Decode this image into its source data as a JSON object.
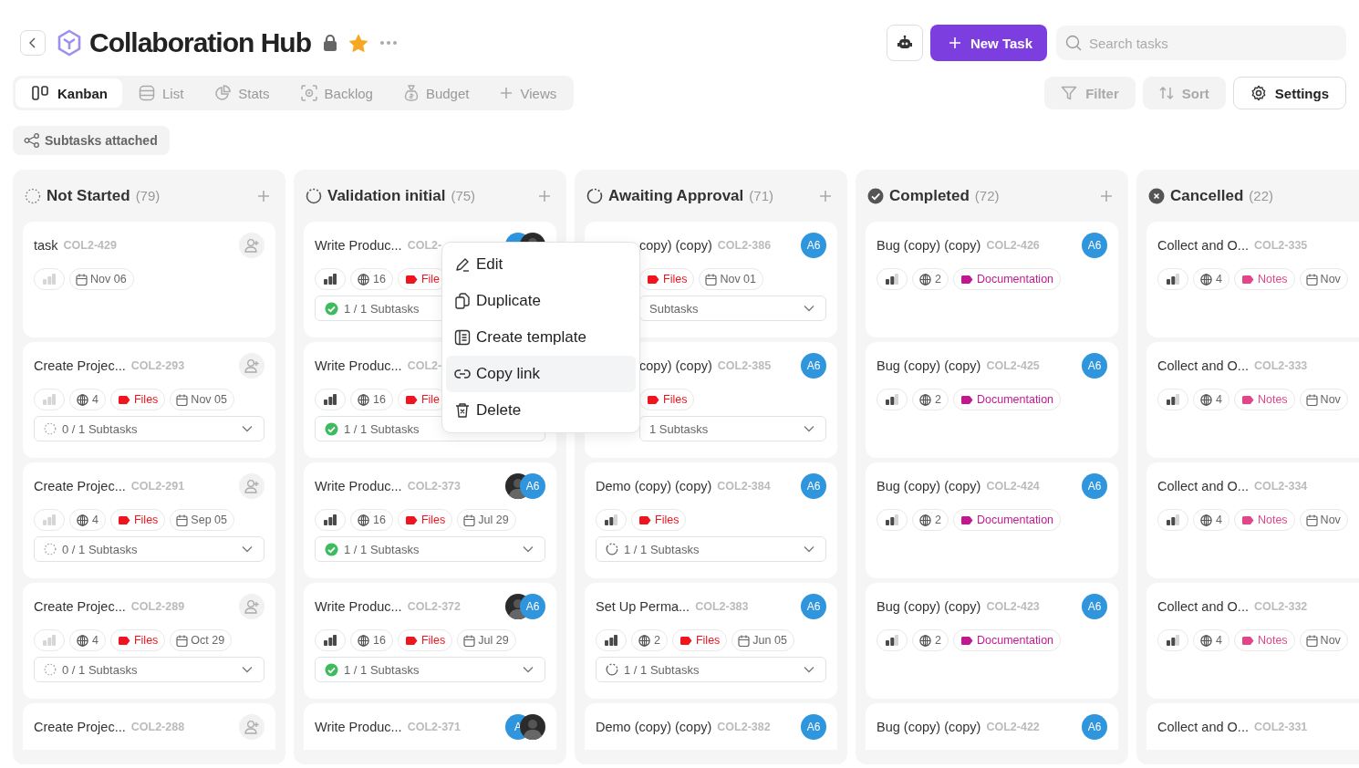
{
  "header": {
    "title": "Collaboration Hub",
    "locked": true,
    "starred": true,
    "new_task_button": "New Task",
    "search": {
      "placeholder": "Search tasks"
    }
  },
  "view_tabs": [
    {
      "label": "Kanban",
      "kind": "kanban",
      "selected": true
    },
    {
      "label": "List",
      "kind": "list",
      "selected": false
    },
    {
      "label": "Stats",
      "kind": "stats",
      "selected": false
    },
    {
      "label": "Backlog",
      "kind": "backlog",
      "selected": false
    },
    {
      "label": "Budget",
      "kind": "budget",
      "selected": false
    }
  ],
  "add_view": "Views",
  "toolbar_buttons": [
    {
      "label": "Filter",
      "kind": "filter",
      "disabled": true
    },
    {
      "label": "Sort",
      "kind": "sort",
      "disabled": true
    },
    {
      "label": "Settings",
      "kind": "settings",
      "disabled": false
    }
  ],
  "active_filter": "Subtasks attached",
  "columns": [
    {
      "title": "Not Started",
      "count": "(79)",
      "kind": "todo",
      "add_button": true,
      "cards": [
        {
          "title": "task",
          "code": "COL2-429",
          "assign_button": true,
          "level": 0,
          "chips": [
            {
              "kind": "date",
              "text": "Nov 06"
            }
          ]
        },
        {
          "title": "Create Projec...",
          "code": "COL2-293",
          "assign_button": true,
          "level": 0,
          "chips": [
            {
              "kind": "stat",
              "text": "4"
            },
            {
              "kind": "label",
              "text": "Files",
              "color": "#f0141e"
            },
            {
              "kind": "date",
              "text": "Nov 05"
            }
          ],
          "subtasks": {
            "text": "0 / 1 Subtasks",
            "kind": "todo"
          }
        },
        {
          "title": "Create Projec...",
          "code": "COL2-291",
          "assign_button": true,
          "level": 0,
          "chips": [
            {
              "kind": "stat",
              "text": "4"
            },
            {
              "kind": "label",
              "text": "Files",
              "color": "#f0141e"
            },
            {
              "kind": "date",
              "text": "Sep 05"
            }
          ],
          "subtasks": {
            "text": "0 / 1 Subtasks",
            "kind": "todo"
          }
        },
        {
          "title": "Create Projec...",
          "code": "COL2-289",
          "assign_button": true,
          "level": 0,
          "chips": [
            {
              "kind": "stat",
              "text": "4"
            },
            {
              "kind": "label",
              "text": "Files",
              "color": "#f0141e"
            },
            {
              "kind": "date",
              "text": "Oct 29"
            }
          ],
          "subtasks": {
            "text": "0 / 1 Subtasks",
            "kind": "todo"
          }
        },
        {
          "title": "Create Projec...",
          "code": "COL2-288",
          "assign_button": true
        }
      ]
    },
    {
      "title": "Validation initial",
      "count": "(75)",
      "kind": "progress",
      "add_button": true,
      "cards": [
        {
          "title": "Write Produc...",
          "code": "COL2-",
          "assignees": [
            {
              "kind": "initials"
            },
            {
              "kind": "photo"
            }
          ],
          "level": 1,
          "chips": [
            {
              "kind": "stat",
              "text": "16"
            },
            {
              "kind": "label",
              "text": "File",
              "color": "#f0141e"
            }
          ],
          "subtasks": {
            "text": "1 / 1 Subtasks",
            "kind": "done",
            "chevron": false
          }
        },
        {
          "title": "Write Produc...",
          "code": "COL2-",
          "level": 1,
          "chips": [
            {
              "kind": "stat",
              "text": "16"
            },
            {
              "kind": "label",
              "text": "File",
              "color": "#f0141e"
            }
          ],
          "subtasks": {
            "text": "1 / 1 Subtasks",
            "kind": "done",
            "chevron": false
          }
        },
        {
          "title": "Write Produc...",
          "code": "COL2-373",
          "assignees": [
            {
              "kind": "photo"
            },
            {
              "kind": "initials",
              "text": "A6"
            }
          ],
          "level": 1,
          "chips": [
            {
              "kind": "stat",
              "text": "16"
            },
            {
              "kind": "label",
              "text": "Files",
              "color": "#f0141e"
            },
            {
              "kind": "date",
              "text": "Jul 29"
            }
          ],
          "subtasks": {
            "text": "1 / 1 Subtasks",
            "kind": "done"
          }
        },
        {
          "title": "Write Produc...",
          "code": "COL2-372",
          "assignees": [
            {
              "kind": "photo"
            },
            {
              "kind": "initials",
              "text": "A6"
            }
          ],
          "level": 1,
          "chips": [
            {
              "kind": "stat",
              "text": "16"
            },
            {
              "kind": "label",
              "text": "Files",
              "color": "#f0141e"
            },
            {
              "kind": "date",
              "text": "Jul 29"
            }
          ],
          "subtasks": {
            "text": "1 / 1 Subtasks",
            "kind": "done"
          }
        },
        {
          "title": "Write Produc...",
          "code": "COL2-371",
          "assignees": [
            {
              "kind": "initials",
              "text": "A"
            },
            {
              "kind": "photo"
            }
          ]
        }
      ]
    },
    {
      "title": "Awaiting Approval",
      "count": "(71)",
      "kind": "review",
      "add_button": true,
      "cards": [
        {
          "title": "copy) (copy)",
          "code": "COL2-386",
          "assignees": [
            {
              "kind": "initials",
              "text": "A6"
            }
          ],
          "chips": [
            {
              "kind": "label",
              "text": "Files",
              "color": "#f0141e"
            },
            {
              "kind": "date",
              "text": "Nov 01"
            }
          ],
          "subtasks": {
            "text": "Subtasks"
          }
        },
        {
          "title": "copy) (copy)",
          "code": "COL2-385",
          "assignees": [
            {
              "kind": "initials",
              "text": "A6"
            }
          ],
          "chips": [
            {
              "kind": "label",
              "text": "Files",
              "color": "#f0141e"
            }
          ],
          "subtasks": {
            "text": "1 Subtasks"
          }
        },
        {
          "title": "Demo (copy) (copy)",
          "code": "COL2-384",
          "assignees": [
            {
              "kind": "initials",
              "text": "A6"
            }
          ],
          "level": 0.67,
          "chips": [
            {
              "kind": "label",
              "text": "Files",
              "color": "#f0141e"
            }
          ],
          "subtasks": {
            "text": "1 / 1 Subtasks",
            "kind": "progress"
          }
        },
        {
          "title": "Set Up Perma...",
          "code": "COL2-383",
          "assignees": [
            {
              "kind": "initials",
              "text": "A6"
            }
          ],
          "level": 1,
          "chips": [
            {
              "kind": "stat",
              "text": "2"
            },
            {
              "kind": "label",
              "text": "Files",
              "color": "#f0141e"
            },
            {
              "kind": "date",
              "text": "Jun 05"
            }
          ],
          "subtasks": {
            "text": "1 / 1 Subtasks",
            "kind": "progress"
          }
        },
        {
          "title": "Demo (copy) (copy)",
          "code": "COL2-382",
          "assignees": [
            {
              "kind": "initials",
              "text": "A6"
            }
          ]
        }
      ]
    },
    {
      "title": "Completed",
      "count": "(72)",
      "kind": "done",
      "add_button": true,
      "cards": [
        {
          "title": "Bug (copy) (copy)",
          "code": "COL2-426",
          "assignees": [
            {
              "kind": "initials",
              "text": "A6"
            }
          ],
          "level": 0.67,
          "chips": [
            {
              "kind": "stat",
              "text": "2"
            },
            {
              "kind": "label",
              "text": "Documentation",
              "color": "#c0198f"
            }
          ]
        },
        {
          "title": "Bug (copy) (copy)",
          "code": "COL2-425",
          "assignees": [
            {
              "kind": "initials",
              "text": "A6"
            }
          ],
          "level": 0.67,
          "chips": [
            {
              "kind": "stat",
              "text": "2"
            },
            {
              "kind": "label",
              "text": "Documentation",
              "color": "#c0198f"
            }
          ]
        },
        {
          "title": "Bug (copy) (copy)",
          "code": "COL2-424",
          "assignees": [
            {
              "kind": "initials",
              "text": "A6"
            }
          ],
          "level": 0.67,
          "chips": [
            {
              "kind": "stat",
              "text": "2"
            },
            {
              "kind": "label",
              "text": "Documentation",
              "color": "#c0198f"
            }
          ]
        },
        {
          "title": "Bug (copy) (copy)",
          "code": "COL2-423",
          "assignees": [
            {
              "kind": "initials",
              "text": "A6"
            }
          ],
          "level": 0.67,
          "chips": [
            {
              "kind": "stat",
              "text": "2"
            },
            {
              "kind": "label",
              "text": "Documentation",
              "color": "#c0198f"
            }
          ]
        },
        {
          "title": "Bug (copy) (copy)",
          "code": "COL2-422",
          "assignees": [
            {
              "kind": "initials",
              "text": "A6"
            }
          ]
        }
      ]
    },
    {
      "title": "Cancelled",
      "count": "(22)",
      "kind": "cancelled",
      "add_button": false,
      "cards": [
        {
          "title": "Collect and O...",
          "code": "COL2-335",
          "level": 0.67,
          "chips": [
            {
              "kind": "stat",
              "text": "4"
            },
            {
              "kind": "label",
              "text": "Notes",
              "color": "#e2468a"
            },
            {
              "kind": "date",
              "text": "Nov"
            }
          ]
        },
        {
          "title": "Collect and O...",
          "code": "COL2-333",
          "level": 0.67,
          "chips": [
            {
              "kind": "stat",
              "text": "4"
            },
            {
              "kind": "label",
              "text": "Notes",
              "color": "#e2468a"
            },
            {
              "kind": "date",
              "text": "Nov"
            }
          ]
        },
        {
          "title": "Collect and O...",
          "code": "COL2-334",
          "level": 0.67,
          "chips": [
            {
              "kind": "stat",
              "text": "4"
            },
            {
              "kind": "label",
              "text": "Notes",
              "color": "#e2468a"
            },
            {
              "kind": "date",
              "text": "Nov"
            }
          ]
        },
        {
          "title": "Collect and O...",
          "code": "COL2-332",
          "level": 0.67,
          "chips": [
            {
              "kind": "stat",
              "text": "4"
            },
            {
              "kind": "label",
              "text": "Notes",
              "color": "#e2468a"
            },
            {
              "kind": "date",
              "text": "Nov"
            }
          ]
        },
        {
          "title": "Collect and O...",
          "code": "COL2-331"
        }
      ]
    }
  ],
  "context_menu": {
    "items": [
      {
        "label": "Edit",
        "kind": "edit",
        "selected": false
      },
      {
        "label": "Duplicate",
        "kind": "duplicate",
        "selected": false
      },
      {
        "label": "Create template",
        "kind": "template",
        "selected": false
      },
      {
        "label": "Copy link",
        "kind": "link",
        "selected": true
      },
      {
        "label": "Delete",
        "kind": "delete",
        "selected": false
      }
    ]
  }
}
